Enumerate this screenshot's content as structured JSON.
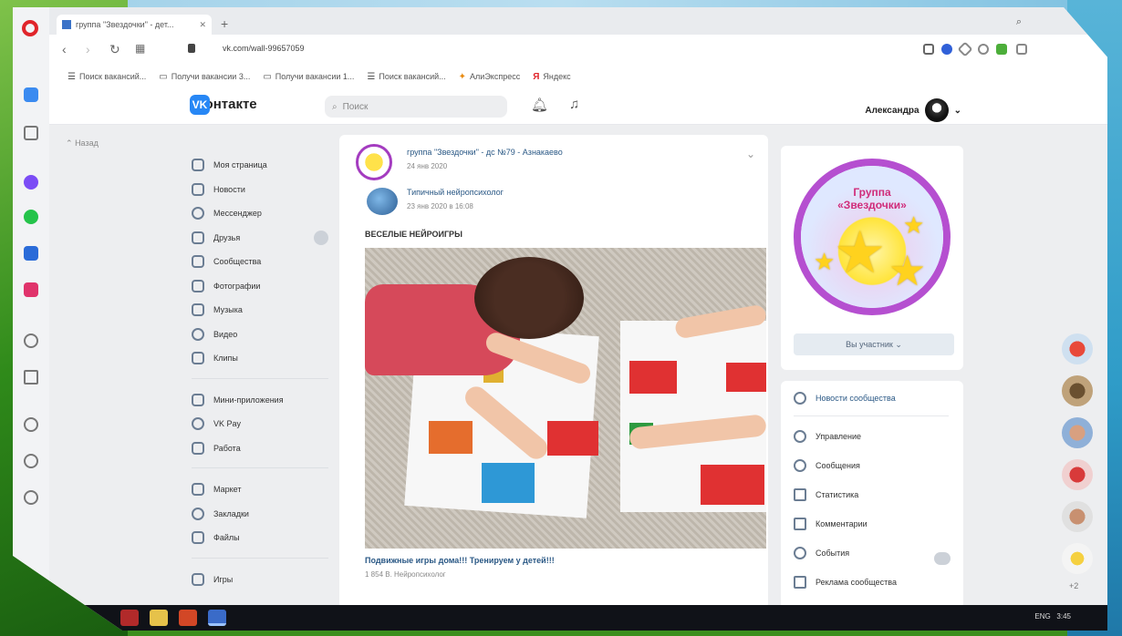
{
  "browser": {
    "tab_title": "группа \"Звездочки\" - дет...",
    "tab_close": "✕",
    "new_tab": "+",
    "tab_search": "⌕",
    "url": "vk.com/wall-99657059"
  },
  "bookmarks": [
    {
      "icon": "☰",
      "label": "Поиск вакансий..."
    },
    {
      "icon": "▭",
      "label": "Получи вакансии 3..."
    },
    {
      "icon": "▭",
      "label": "Получи вакансии 1..."
    },
    {
      "icon": "☰",
      "label": "Поиск вакансий..."
    },
    {
      "icon": "✦",
      "label": "АлиЭкспресс"
    },
    {
      "icon": "Я",
      "label": "Яндекс"
    }
  ],
  "vk": {
    "logo": "вконтакте",
    "logo_mark": "VK",
    "search_placeholder": "Поиск",
    "user_name": "Александра",
    "back_label": "Назад"
  },
  "menu": [
    {
      "label": "Моя страница"
    },
    {
      "label": "Новости"
    },
    {
      "label": "Мессенджер"
    },
    {
      "label": "Друзья",
      "badge": true
    },
    {
      "label": "Сообщества"
    },
    {
      "label": "Фотографии"
    },
    {
      "label": "Музыка"
    },
    {
      "label": "Видео"
    },
    {
      "label": "Клипы"
    }
  ],
  "menu2": [
    {
      "label": "Мини-приложения"
    },
    {
      "label": "VK Pay"
    },
    {
      "label": "Работа"
    }
  ],
  "menu3": [
    {
      "label": "Маркет"
    },
    {
      "label": "Закладки"
    },
    {
      "label": "Файлы"
    }
  ],
  "menu4": [
    {
      "label": "Игры"
    }
  ],
  "post": {
    "author": "группа \"Звездочки\" - дс №79 - Азнакаево",
    "date": "24 янв 2020",
    "repost_author": "Типичный нейропсихолог",
    "repost_date": "23 янв 2020 в 16:08",
    "text": "ВЕСЕЛЫЕ НЕЙРОИГРЫ",
    "caption": "Подвижные игры дома!!! Тренируем у детей!!!",
    "caption_sub": "1 854 В. Нейропсихолог"
  },
  "group": {
    "logo_text": "Группа «Звездочки»",
    "member_button": "Вы участник ⌄"
  },
  "right_menu": [
    {
      "label": "Новости сообщества",
      "primary": true
    },
    {
      "label": "Управление"
    },
    {
      "label": "Сообщения"
    },
    {
      "label": "Статистика"
    },
    {
      "label": "Комментарии"
    },
    {
      "label": "События"
    },
    {
      "label": "Реклама сообщества"
    }
  ],
  "chat_more": "+2",
  "tray": {
    "lang": "ENG",
    "time": "3:45"
  },
  "colors": {
    "vk_blue": "#2787f5",
    "link": "#2a5885",
    "group_ring": "#b54fd0"
  }
}
